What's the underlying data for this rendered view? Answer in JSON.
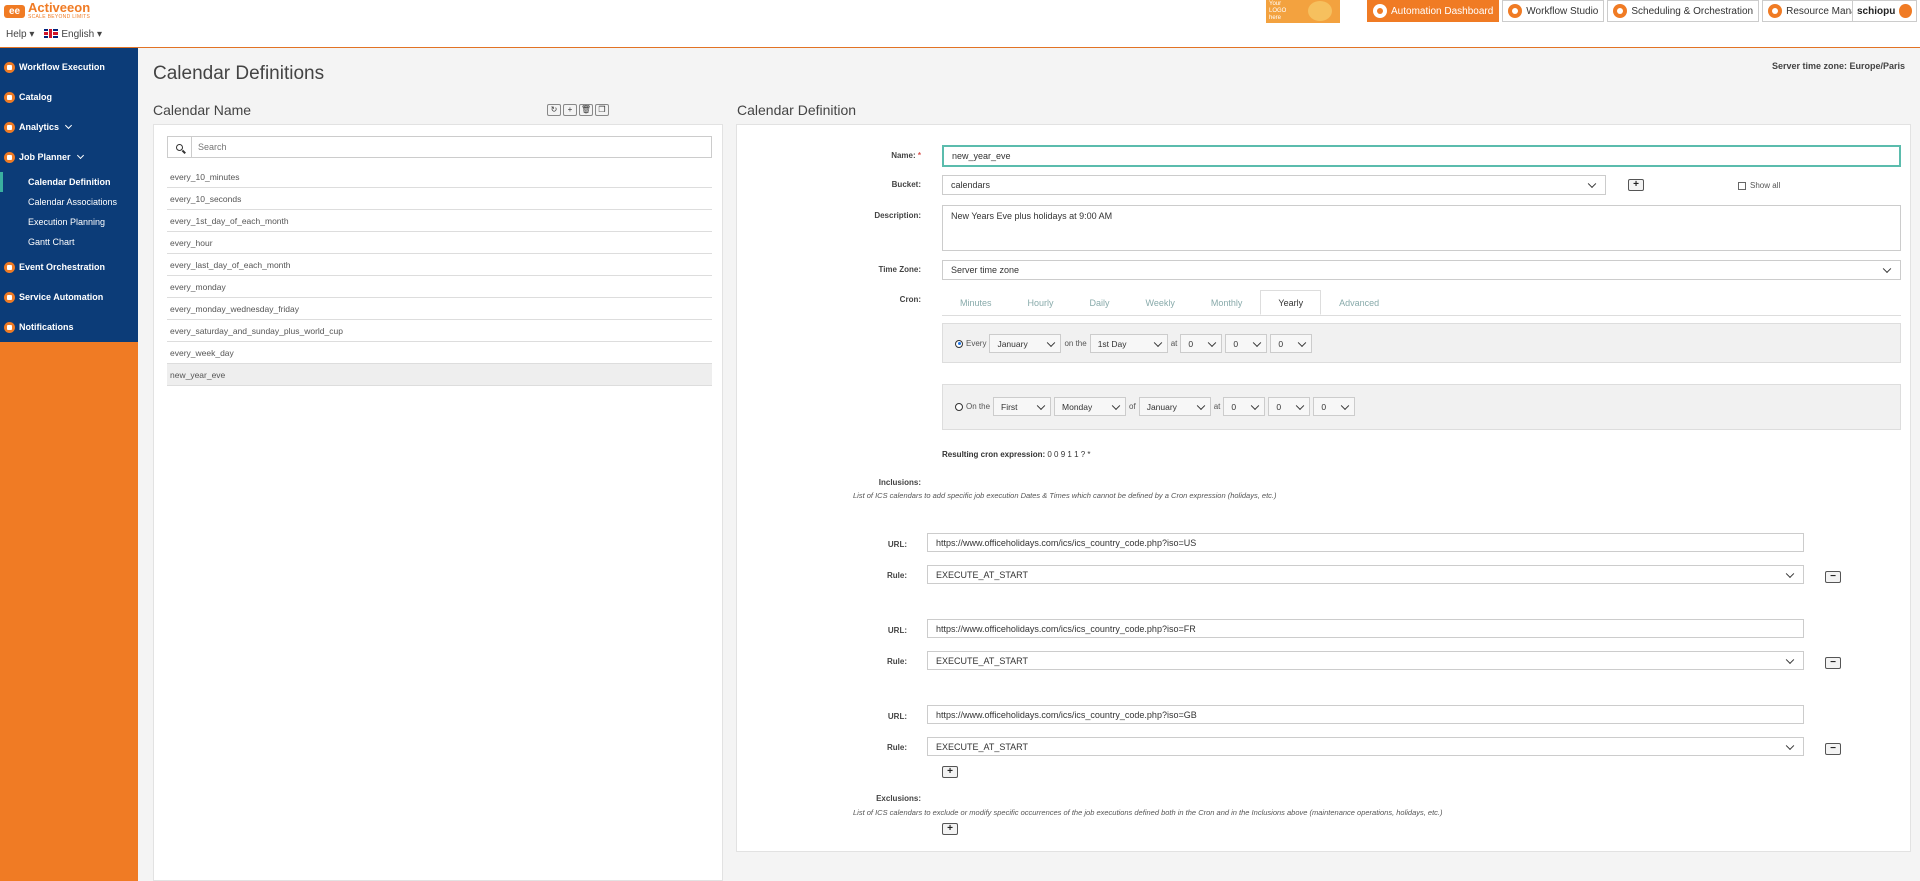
{
  "brand": {
    "name": "Activeeon",
    "tagline": "SCALE BEYOND LIMITS"
  },
  "header": {
    "help": "Help",
    "language": "English",
    "your_logo": "Your LOGO here",
    "tabs": [
      "Automation Dashboard",
      "Workflow Studio",
      "Scheduling & Orchestration",
      "Resource Manager"
    ],
    "user": "schiopu"
  },
  "sidebar": {
    "items": [
      {
        "label": "Workflow Execution"
      },
      {
        "label": "Catalog"
      },
      {
        "label": "Analytics"
      },
      {
        "label": "Job Planner"
      }
    ],
    "sub_items": [
      "Calendar Definition",
      "Calendar Associations",
      "Execution Planning",
      "Gantt Chart"
    ],
    "items_after": [
      {
        "label": "Event Orchestration"
      },
      {
        "label": "Service Automation"
      },
      {
        "label": "Notifications"
      }
    ]
  },
  "page": {
    "title": "Calendar Definitions",
    "server_tz": "Server time zone: Europe/Paris"
  },
  "left": {
    "title": "Calendar Name",
    "search_placeholder": "Search",
    "calendars": [
      "every_10_minutes",
      "every_10_seconds",
      "every_1st_day_of_each_month",
      "every_hour",
      "every_last_day_of_each_month",
      "every_monday",
      "every_monday_wednesday_friday",
      "every_saturday_and_sunday_plus_world_cup",
      "every_week_day",
      "new_year_eve"
    ],
    "selected": "new_year_eve"
  },
  "right": {
    "title": "Calendar Definition",
    "name_label": "Name:",
    "name_value": "new_year_eve",
    "bucket_label": "Bucket:",
    "bucket_value": "calendars",
    "show_all": "Show all",
    "description_label": "Description:",
    "description_value": "New Years Eve plus holidays at 9:00 AM",
    "timezone_label": "Time Zone:",
    "timezone_value": "Server time zone",
    "cron_label": "Cron:",
    "cron_tabs": [
      "Minutes",
      "Hourly",
      "Daily",
      "Weekly",
      "Monthly",
      "Yearly",
      "Advanced"
    ],
    "active_tab": "Yearly",
    "yearly_every": {
      "radio_label": "Every",
      "month": "January",
      "on_the": "on the",
      "day": "1st Day",
      "at": "at",
      "h": "0",
      "m": "0",
      "s": "0"
    },
    "yearly_onthe": {
      "radio_label": "On the",
      "ordinal": "First",
      "weekday": "Monday",
      "of": "of",
      "month": "January",
      "at": "at",
      "h": "0",
      "m": "0",
      "s": "0"
    },
    "cron_result_label": "Resulting cron expression:",
    "cron_result_value": "0 0 9 1 1 ? *",
    "inclusions_label": "Inclusions:",
    "inclusions_note": "List of ICS calendars to add specific job execution Dates & Times which cannot be defined by a Cron expression (holidays, etc.)",
    "url_label": "URL:",
    "rule_label": "Rule:",
    "inclusions": [
      {
        "url": "https://www.officeholidays.com/ics/ics_country_code.php?iso=US",
        "rule": "EXECUTE_AT_START"
      },
      {
        "url": "https://www.officeholidays.com/ics/ics_country_code.php?iso=FR",
        "rule": "EXECUTE_AT_START"
      },
      {
        "url": "https://www.officeholidays.com/ics/ics_country_code.php?iso=GB",
        "rule": "EXECUTE_AT_START"
      }
    ],
    "exclusions_label": "Exclusions:",
    "exclusions_note": "List of ICS calendars to exclude or modify specific occurrences of the job executions defined both in the Cron and in the Inclusions above (maintenance operations, holidays, etc.)"
  },
  "colors": {
    "accent": "#f07b24",
    "sidebar": "#0c3c78",
    "focus": "#5bbcad"
  }
}
